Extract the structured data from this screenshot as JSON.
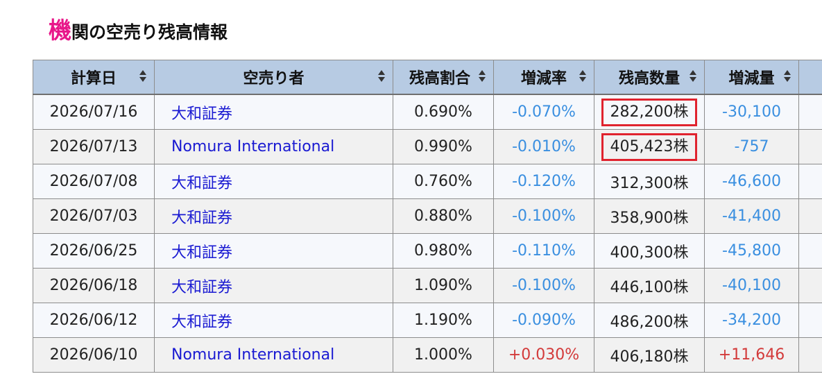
{
  "title": {
    "first_char": "機",
    "rest": "関の空売り残高情報"
  },
  "table": {
    "headers": [
      "計算日",
      "空売り者",
      "残高割合",
      "増減率",
      "残高数量",
      "増減量",
      ""
    ],
    "rows": [
      {
        "date": "2026/07/16",
        "seller": "大和証券",
        "ratio": "0.690%",
        "change_rate": "-0.070%",
        "quantity": "282,200株",
        "change_qty": "-30,100"
      },
      {
        "date": "2026/07/13",
        "seller": "Nomura International",
        "ratio": "0.990%",
        "change_rate": "-0.010%",
        "quantity": "405,423株",
        "change_qty": "-757"
      },
      {
        "date": "2026/07/08",
        "seller": "大和証券",
        "ratio": "0.760%",
        "change_rate": "-0.120%",
        "quantity": "312,300株",
        "change_qty": "-46,600"
      },
      {
        "date": "2026/07/03",
        "seller": "大和証券",
        "ratio": "0.880%",
        "change_rate": "-0.100%",
        "quantity": "358,900株",
        "change_qty": "-41,400"
      },
      {
        "date": "2026/06/25",
        "seller": "大和証券",
        "ratio": "0.980%",
        "change_rate": "-0.110%",
        "quantity": "400,300株",
        "change_qty": "-45,800"
      },
      {
        "date": "2026/06/18",
        "seller": "大和証券",
        "ratio": "1.090%",
        "change_rate": "-0.100%",
        "quantity": "446,100株",
        "change_qty": "-40,100"
      },
      {
        "date": "2026/06/12",
        "seller": "大和証券",
        "ratio": "1.190%",
        "change_rate": "-0.090%",
        "quantity": "486,200株",
        "change_qty": "-34,200"
      },
      {
        "date": "2026/06/10",
        "seller": "Nomura International",
        "ratio": "1.000%",
        "change_rate": "+0.030%",
        "quantity": "406,180株",
        "change_qty": "+11,646"
      }
    ]
  },
  "colors": {
    "header_bg": "#b7cbe3",
    "title_accent": "#e8178a",
    "link": "#1a1ad2",
    "negative": "#3a8fe0",
    "positive": "#d33a3a",
    "highlight_box": "#e0232e"
  },
  "icons": {
    "sort": "sort-arrows-icon"
  }
}
